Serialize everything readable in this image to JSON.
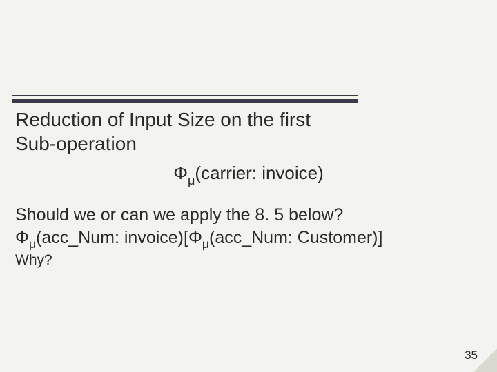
{
  "title_line1": "Reduction of Input Size on the first",
  "title_line2": "Sub-operation",
  "formula_phi": "Φ",
  "formula_sub": "μ",
  "formula_args_center": "(carrier: invoice)",
  "question": "Should we or can we apply the 8. 5 below?",
  "expr_part1": "(acc_Num: invoice)[",
  "expr_part2": "(acc_Num: Customer)]",
  "why": "Why?",
  "page": "35"
}
